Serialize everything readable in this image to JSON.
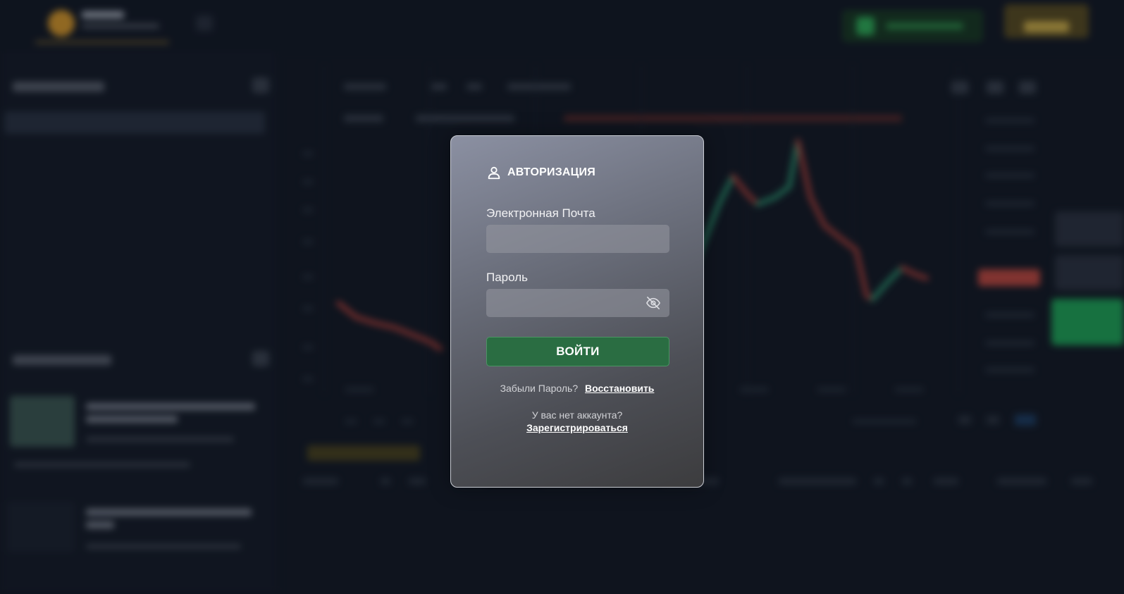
{
  "login": {
    "title": "АВТОРИЗАЦИЯ",
    "email_label": "Электронная Почта",
    "email_value": "",
    "password_label": "Пароль",
    "password_value": "",
    "submit_label": "ВОЙТИ",
    "forgot_text": "Забыли Пароль?",
    "restore_link": "Восстановить",
    "no_account_text": "У вас нет аккаунта?",
    "register_link": "Зарегистрироваться",
    "icons": {
      "title": "user-icon",
      "password_toggle": "eye-off-icon"
    }
  },
  "colors": {
    "button_green": "#2a6d42",
    "background": "#131a26",
    "candle_up": "#2fa37a",
    "candle_down": "#c0443d"
  }
}
